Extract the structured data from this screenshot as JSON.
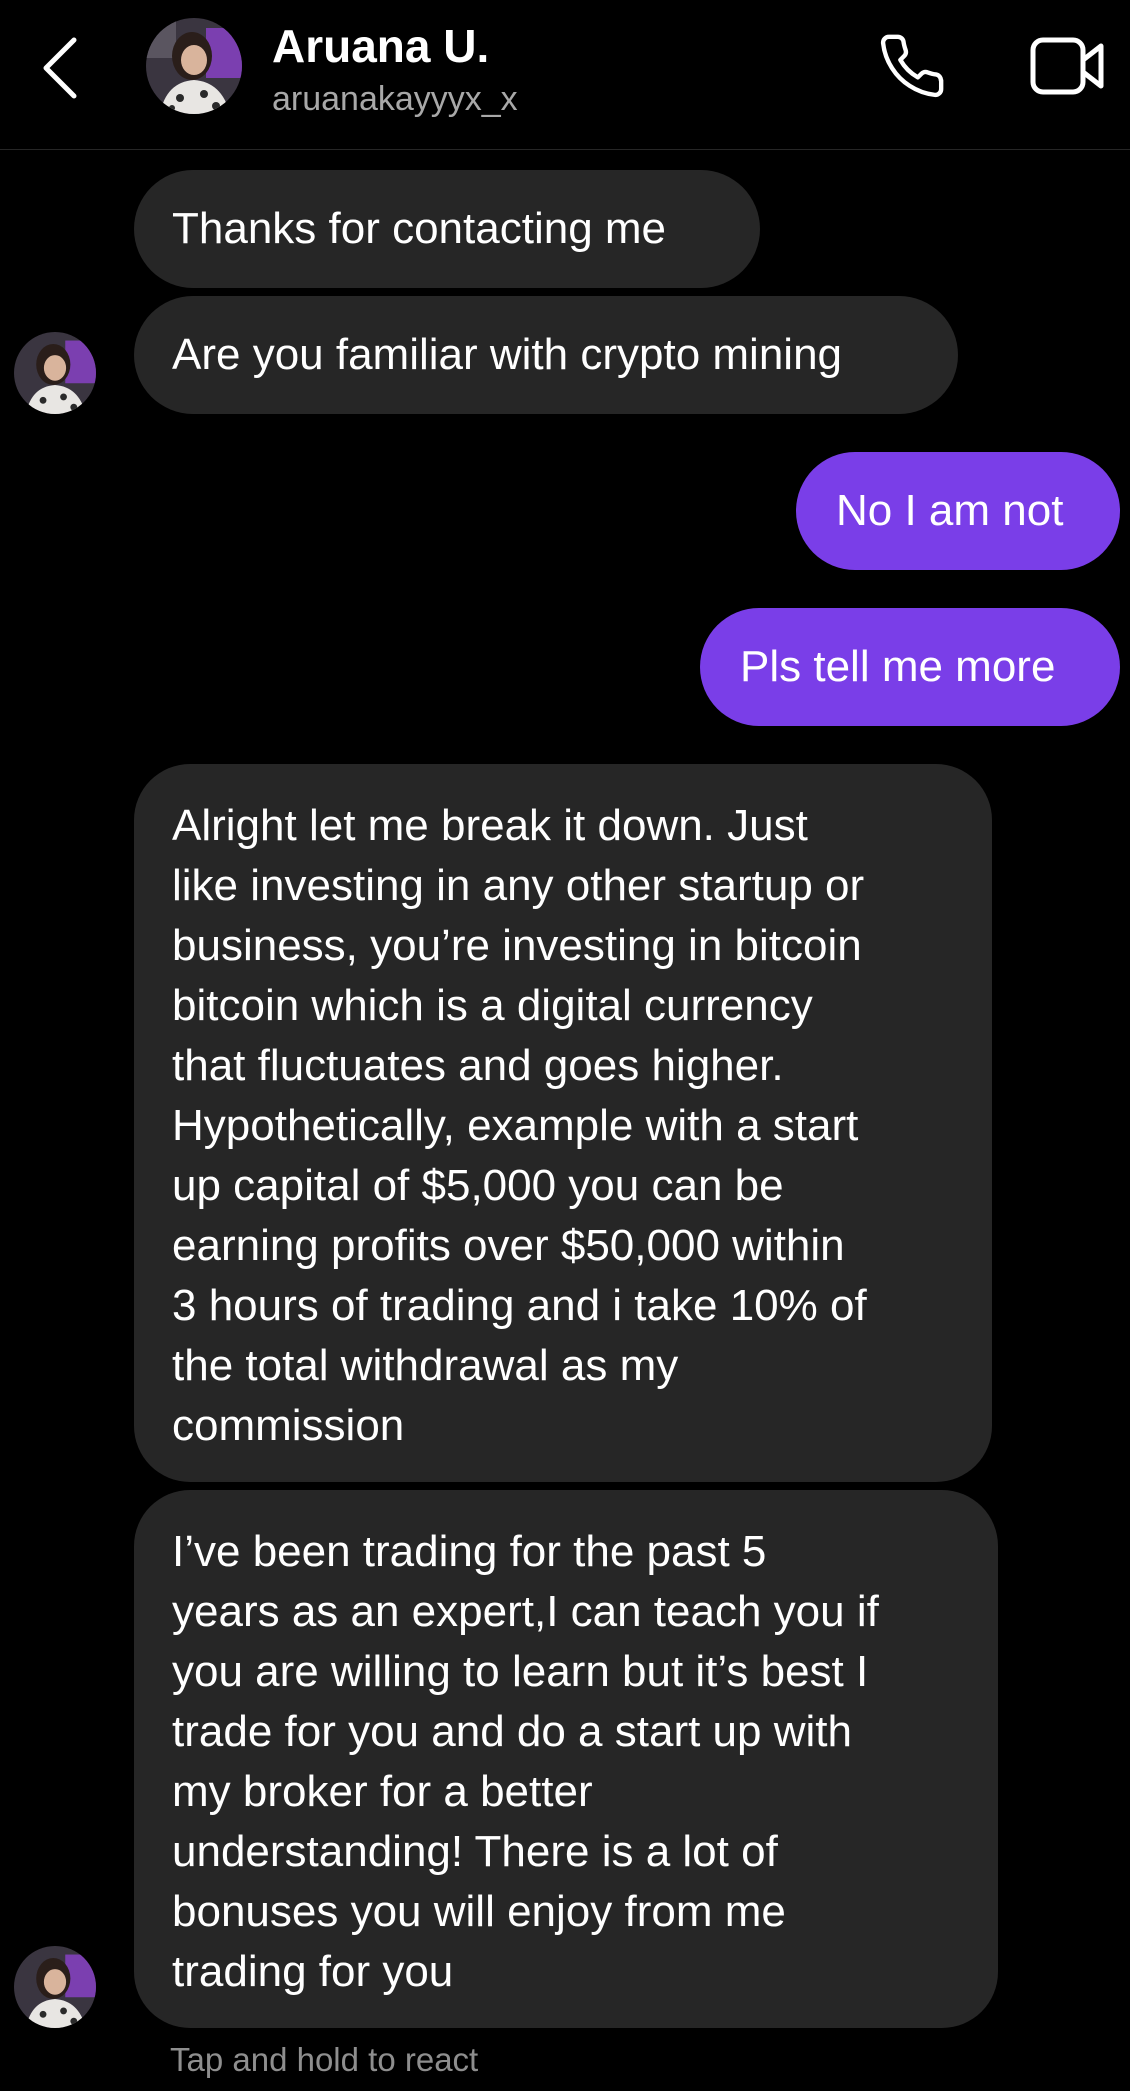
{
  "header": {
    "name": "Aruana U.",
    "handle": "aruanakayyyx_x",
    "back_icon": "chevron-left-icon",
    "call_icon": "phone-icon",
    "video_icon": "video-camera-icon"
  },
  "messages": [
    {
      "sender": "them",
      "lines": [
        "Thanks for contacting me"
      ]
    },
    {
      "sender": "them",
      "lines": [
        "Are you familiar with crypto mining"
      ]
    },
    {
      "sender": "me",
      "lines": [
        "No I am not"
      ]
    },
    {
      "sender": "me",
      "lines": [
        "Pls tell me more"
      ]
    },
    {
      "sender": "them",
      "lines": [
        "Alright let me break it down. Just",
        "like investing in any other startup or",
        "business, you’re investing in bitcoin",
        "bitcoin which is a digital currency",
        "that fluctuates and goes higher.",
        "Hypothetically, example with a start",
        "up capital of $5,000 you can be",
        "earning profits over $50,000 within",
        "3 hours of trading and i take 10% of",
        "the total withdrawal as my",
        "commission"
      ]
    },
    {
      "sender": "them",
      "lines": [
        "I’ve been trading for the past 5",
        "years as an expert,I can teach you if",
        "you are willing to learn but it’s best I",
        "trade for you and do a start up with",
        "my broker for a better",
        "understanding! There is a lot of",
        "bonuses you will enjoy from me",
        "trading for you"
      ]
    }
  ],
  "hint": "Tap and hold to react",
  "colors": {
    "background": "#000000",
    "incoming_bubble": "#262626",
    "outgoing_bubble": "#7a3ee8",
    "secondary_text": "#a8a8a8"
  }
}
